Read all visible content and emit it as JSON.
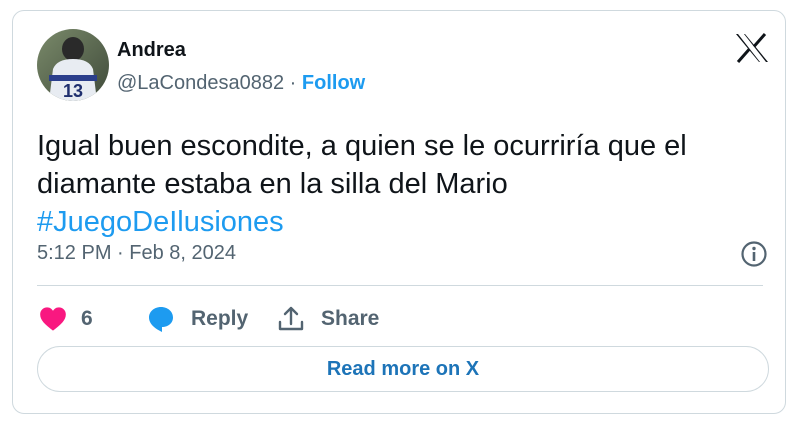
{
  "author": {
    "name": "Andrea",
    "handle": "@LaCondesa0882",
    "separator": "·",
    "follow_label": "Follow"
  },
  "tweet": {
    "text_line1": "Igual buen escondite, a quien se le ocurriría que el",
    "text_line2": "diamante estaba en la silla del Mario",
    "hashtag": "#JuegoDeIlusiones",
    "timestamp": "5:12 PM · Feb 8, 2024"
  },
  "actions": {
    "like_count": "6",
    "reply_label": "Reply",
    "share_label": "Share"
  },
  "read_more_label": "Read more on X",
  "icons": {
    "logo": "x-logo-icon",
    "info": "info-icon",
    "like": "heart-icon",
    "reply": "speech-bubble-icon",
    "share": "share-upload-icon"
  },
  "colors": {
    "accent": "#1d9bf0",
    "heart": "#f91880",
    "text": "#0f1419",
    "muted": "#536471",
    "border": "#cfd9de"
  }
}
